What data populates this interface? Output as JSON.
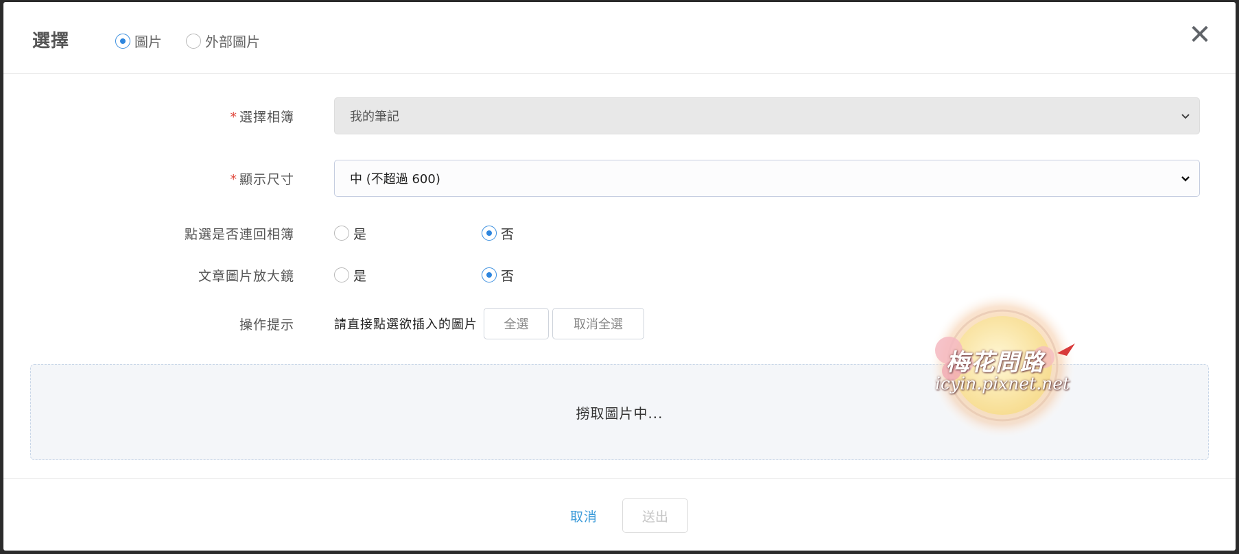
{
  "header": {
    "title": "選擇",
    "source_options": [
      {
        "label": "圖片",
        "checked": true
      },
      {
        "label": "外部圖片",
        "checked": false
      }
    ],
    "close_icon": "close-icon"
  },
  "form": {
    "album": {
      "label": "選擇相簿",
      "required": true,
      "value": "我的筆記",
      "disabled": true
    },
    "size": {
      "label": "顯示尺寸",
      "required": true,
      "value": "中 (不超過 600)"
    },
    "link_back": {
      "label": "點選是否連回相簿",
      "yes": "是",
      "no": "否",
      "selected": "否"
    },
    "magnifier": {
      "label": "文章圖片放大鏡",
      "yes": "是",
      "no": "否",
      "selected": "否"
    },
    "tip": {
      "label": "操作提示",
      "text": "請直接點選欲插入的圖片",
      "select_all": "全選",
      "deselect_all": "取消全選"
    }
  },
  "dropzone": {
    "status": "撈取圖片中..."
  },
  "footer": {
    "cancel": "取消",
    "submit": "送出"
  },
  "watermark": {
    "title": "梅花問路",
    "url": "icyin.pixnet.net"
  },
  "colors": {
    "accent": "#2e86de",
    "required": "#e0463a",
    "link": "#3a9ad9"
  }
}
